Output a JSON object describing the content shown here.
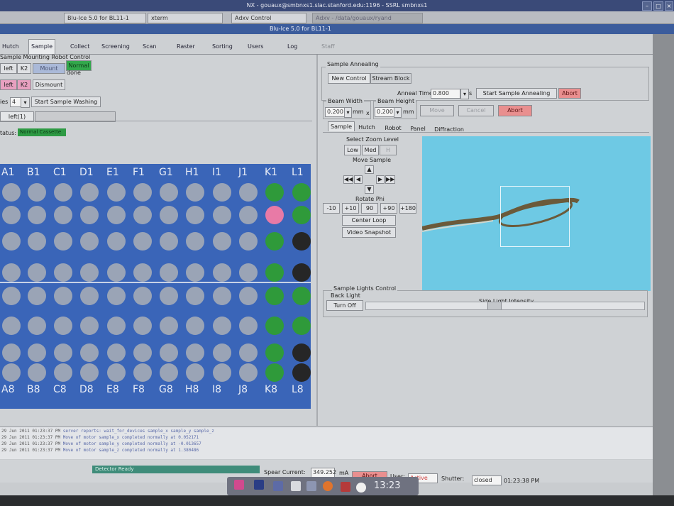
{
  "nx_title": "NX - gouaux@smbnxs1.slac.stanford.edu:1196 - SSRL smbnxs1",
  "taskbar_tabs": [
    "Blu-Ice 5.0 for BL11-1",
    "xterm",
    "Adxv Control",
    "Adxv - /data/gouaux/ryand"
  ],
  "window_title": "Blu-Ice 5.0 for BL11-1",
  "main_tabs": [
    "Hutch",
    "Sample",
    "Collect",
    "Screening",
    "Scan",
    "Raster",
    "Sorting",
    "Users",
    "Log",
    "Staff"
  ],
  "left": {
    "robot_control_label": "Sample Mounting Robot Control",
    "row1_left": "left",
    "row1_k2": "K2",
    "mount_button": "Mount",
    "normal_status": "Normal",
    "done_text": "done",
    "row2_left": "left",
    "row2_k2": "K2",
    "dismount_button": "Dismount",
    "cycles_label": "ies",
    "cycles_value": "4",
    "wash_button": "Start Sample Washing",
    "cassette_tab": "left(1)",
    "status_label": "tatus:",
    "status_value": "Normal Cassette",
    "columns": [
      "A1",
      "B1",
      "C1",
      "D1",
      "E1",
      "F1",
      "G1",
      "H1",
      "I1",
      "J1",
      "K1",
      "L1"
    ],
    "bottom_labels": [
      "A8",
      "B8",
      "C8",
      "D8",
      "E8",
      "F8",
      "G8",
      "H8",
      "I8",
      "J8",
      "K8",
      "L8"
    ]
  },
  "right": {
    "annealing_label": "Sample Annealing",
    "new_control_tab": "New Control",
    "stream_block_tab": "Stream Block",
    "anneal_time_label": "Anneal Time",
    "anneal_time_value": "0.800",
    "anneal_unit": "s",
    "start_anneal_button": "Start Sample Annealing",
    "abort_anneal_button": "Abort",
    "beam_width_label": "Beam Width",
    "beam_width_value": "0.200",
    "beam_width_unit": "mm",
    "times": "x",
    "beam_height_label": "Beam Height",
    "beam_height_value": "0.200",
    "beam_height_unit": "mm",
    "move_button": "Move",
    "cancel_button": "Cancel",
    "abort_button": "Abort",
    "subtabs": [
      "Sample",
      "Hutch",
      "Robot",
      "Panel",
      "Diffraction"
    ],
    "zoom_label": "Select Zoom Level",
    "zoom_low": "Low",
    "zoom_med": "Med",
    "zoom_high": "H",
    "move_sample_label": "Move Sample",
    "rotate_label": "Rotate Phi",
    "rotate_buttons": [
      "-10",
      "+10",
      "90",
      "+90",
      "+180"
    ],
    "center_loop_button": "Center Loop",
    "video_snapshot_button": "Video Snapshot",
    "lights_label": "Sample Lights Control",
    "back_light_label": "Back Light",
    "turn_off_button": "Turn Off",
    "side_light_label": "Side Light Intensity",
    "side_light_level": 0.46
  },
  "log_lines": [
    {
      "time": "29 Jun 2011 01:23:37 PM",
      "msg": "server reports: wait_for_devices sample_x sample_y sample_z"
    },
    {
      "time": "29 Jun 2011 01:23:37 PM",
      "msg": "Move of motor sample_x completed normally at  0.052171"
    },
    {
      "time": "29 Jun 2011 01:23:37 PM",
      "msg": "Move of motor sample_y completed normally at  -0.013657"
    },
    {
      "time": "29 Jun 2011 01:23:37 PM",
      "msg": "Move of motor sample_z completed normally at  1.380486"
    }
  ],
  "status": {
    "detector": "Detector Ready",
    "spear_label": "Spear Current:",
    "spear_value": "349.252",
    "spear_unit": "mA",
    "abort": "Abort",
    "user_label": "User:",
    "user_value": "Active",
    "shutter_label": "Shutter:",
    "shutter_value": "closed",
    "time": "01:23:38 PM"
  },
  "clock": "13:23"
}
